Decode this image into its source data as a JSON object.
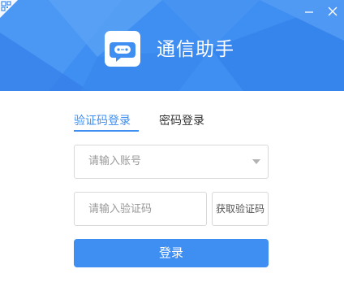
{
  "app": {
    "title": "通信助手",
    "logo_icon": "robot-chat-bubble-icon"
  },
  "window_controls": {
    "qr_icon": "qr-code-icon",
    "minimize_icon": "minimize-icon",
    "close_icon": "close-icon"
  },
  "tabs": {
    "sms_login": "验证码登录",
    "password_login": "密码登录",
    "active": "sms_login"
  },
  "form": {
    "account_placeholder": "请输入账号",
    "code_placeholder": "请输入验证码",
    "get_code_label": "获取验证码",
    "login_label": "登录"
  },
  "colors": {
    "accent": "#3f8ef1",
    "banner_light": "#6aaaf6",
    "banner_dark": "#2f7de9",
    "placeholder": "#999999",
    "border": "#d9d9d9"
  }
}
